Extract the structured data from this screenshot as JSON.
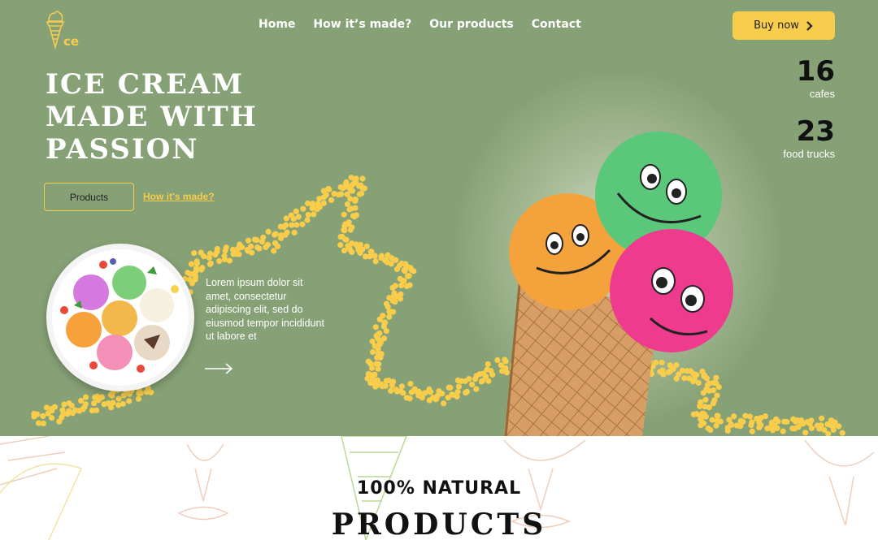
{
  "logo": {
    "text": "ce",
    "icon": "ice-cream-cone-icon"
  },
  "nav": [
    "Home",
    "How it’s made?",
    "Our products",
    "Contact"
  ],
  "buy_button": {
    "label": "Buy now",
    "icon": "chevron-right-icon"
  },
  "headline": [
    "ICE CREAM",
    "MADE WITH",
    "PASSION"
  ],
  "actions": {
    "products_label": "Products",
    "how_made_label": "How it's made?"
  },
  "stats": [
    {
      "value": "16",
      "label": "cafes"
    },
    {
      "value": "23",
      "label": "food trucks"
    }
  ],
  "description": "Lorem ipsum dolor sit amet, consectetur adipiscing elit, sed do eiusmod tempor incididunt ut labore et",
  "section": {
    "subtitle": "100% NATURAL",
    "title": "PRODUCTS"
  },
  "colors": {
    "hero_bg": "#87a176",
    "accent_yellow": "#f7cd4b",
    "text_dark": "#111111"
  }
}
